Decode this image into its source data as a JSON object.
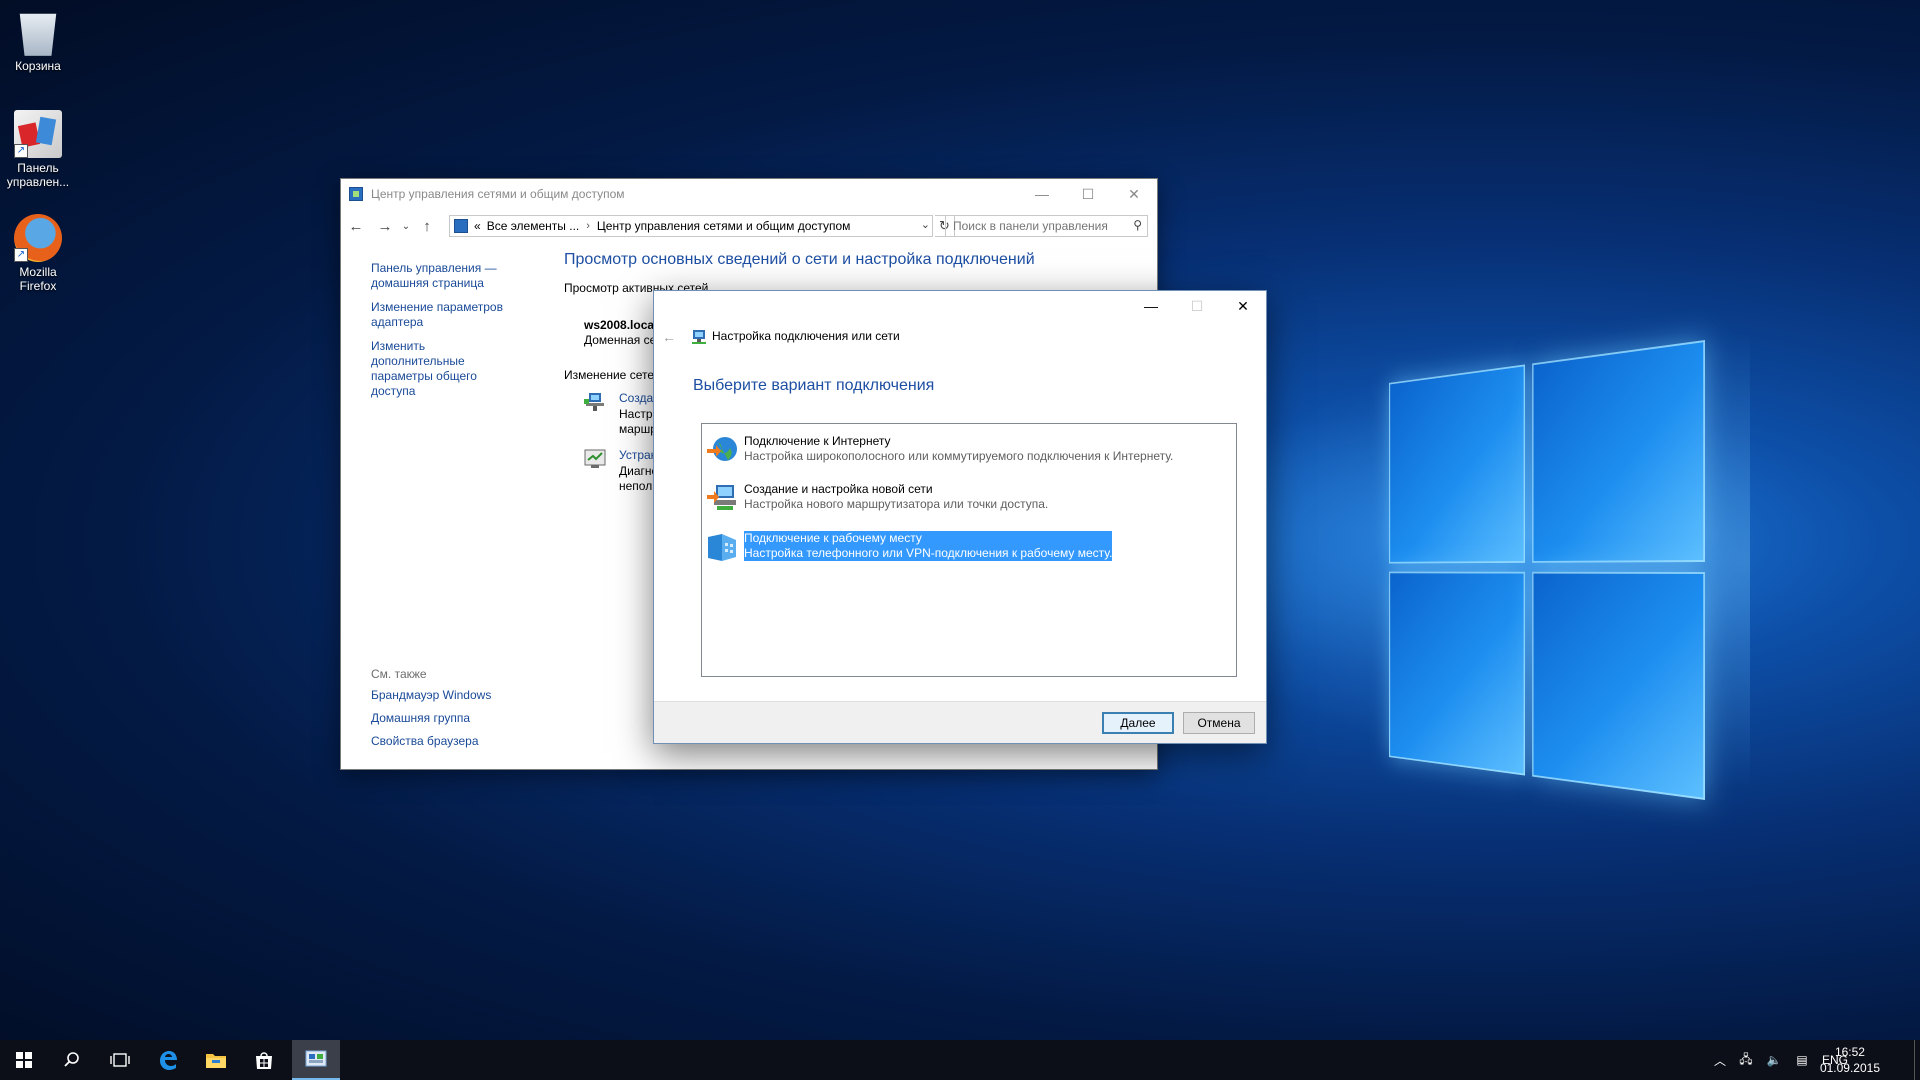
{
  "desktop": {
    "icons": [
      {
        "label": "Корзина",
        "icon": "recycle-bin-icon"
      },
      {
        "label": "Панель управлен...",
        "icon": "control-panel-icon"
      },
      {
        "label": "Mozilla Firefox",
        "icon": "firefox-icon"
      }
    ]
  },
  "main_window": {
    "title": "Центр управления сетями и общим доступом",
    "address": {
      "crumb_prefix": "«",
      "crumb_1": "Все элементы ...",
      "crumb_2": "Центр управления сетями и общим доступом"
    },
    "search_placeholder": "Поиск в панели управления",
    "left_nav": [
      "Панель управления — домашняя страница",
      "Изменение параметров адаптера",
      "Изменить дополнительные параметры общего доступа"
    ],
    "see_also": {
      "header": "См. также",
      "links": [
        "Брандмауэр Windows",
        "Домашняя группа",
        "Свойства браузера"
      ]
    },
    "heading": "Просмотр основных сведений о сети и настройка подключений",
    "active_networks_label": "Просмотр активных сетей",
    "network": {
      "name": "ws2008.loca",
      "type": "Доменная се"
    },
    "change_settings_label": "Изменение сете",
    "tasks": [
      {
        "link": "Создан",
        "desc_1": "Настро",
        "desc_2": "маршр"
      },
      {
        "link": "Устран",
        "desc_1": "Диагно",
        "desc_2": "непол"
      }
    ]
  },
  "dialog": {
    "title": "Настройка подключения или сети",
    "heading": "Выберите вариант подключения",
    "options": [
      {
        "title": "Подключение к Интернету",
        "desc": "Настройка широкополосного или коммутируемого подключения к Интернету.",
        "icon": "internet-globe-icon"
      },
      {
        "title": "Создание и настройка новой сети",
        "desc": "Настройка нового маршрутизатора или точки доступа.",
        "icon": "new-network-icon"
      },
      {
        "title": "Подключение к рабочему месту",
        "desc": "Настройка телефонного или VPN-подключения к рабочему месту.",
        "icon": "workplace-icon",
        "selected": true
      }
    ],
    "next_button": "Далее",
    "cancel_button": "Отмена"
  },
  "taskbar": {
    "language": "ENG",
    "time": "16:52",
    "date": "01.09.2015",
    "pinned": [
      "start-icon",
      "search-icon",
      "task-view-icon",
      "edge-icon",
      "file-explorer-icon",
      "store-icon",
      "control-panel-icon"
    ]
  },
  "colors": {
    "link": "#1a4a98",
    "heading": "#1e4fa3",
    "selection": "#3399ff",
    "taskbar": "#0c0f17"
  }
}
